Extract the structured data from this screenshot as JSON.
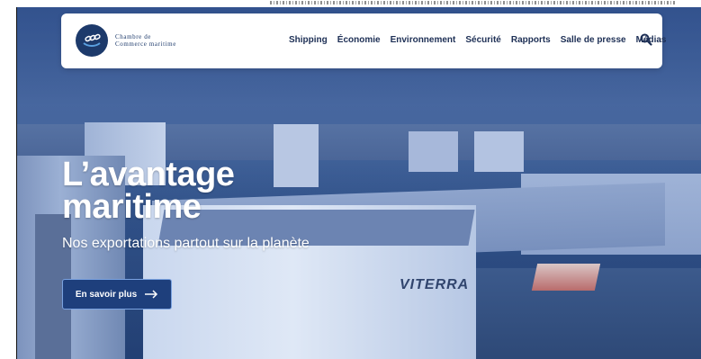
{
  "logo": {
    "line1": "Chambre de",
    "line2": "Commerce maritime"
  },
  "nav": {
    "items": [
      "Shipping",
      "Économie",
      "Environnement",
      "Sécurité",
      "Rapports",
      "Salle de presse",
      "Médias"
    ],
    "search_icon": "search-icon"
  },
  "hero": {
    "headline_line1": "L’avantage",
    "headline_line2": "maritime",
    "subtitle": "Nos exportations partout sur la planète",
    "cta_label": "En savoir plus",
    "cta_icon": "arrow-right-icon",
    "photo_text": "VITERRA"
  },
  "colors": {
    "navy": "#1d3a6b",
    "cta_bg": "#1e3f7c",
    "overlay": "#3f5f93"
  }
}
